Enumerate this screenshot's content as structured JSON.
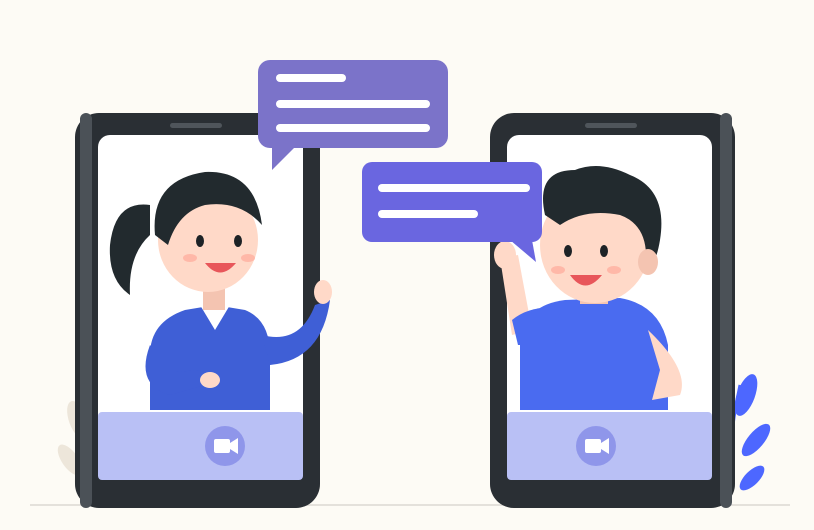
{
  "scene": {
    "background": "#fdfbf5",
    "phone_body": "#3a3f45",
    "phone_screen": "#ffffff",
    "bubble_left": "#7b73c9",
    "bubble_right": "#6a66e0",
    "woman_shirt": "#3f5fd6",
    "man_shirt": "#4a6bf0",
    "skin": "#ffd9c8",
    "hair": "#222a2e",
    "call_bar": "#b9c0f5",
    "camera_circle": "#8f96ea",
    "plant_left": "#ece4d8",
    "plant_right": "#4d67ff"
  },
  "icons": {
    "left_camera": "video-camera-icon",
    "right_camera": "video-camera-icon"
  }
}
